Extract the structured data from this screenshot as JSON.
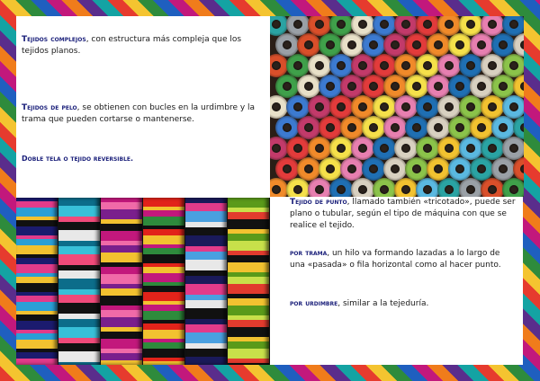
{
  "left_panel": {
    "p1_term": "Tejidos complejos",
    "p1_text": ", con estructura más compleja que los tejidos planos.",
    "p2_term": "Tejidos de pelo",
    "p2_text": ", se obtienen con bucles en la urdimbre y la trama que pueden cortarse o mantenerse.",
    "p3_term": "Doble tela o tejido reversible."
  },
  "right_panel": {
    "p4_term": "Tejido de punto",
    "p4_text": ", llamado también «tricotado», puede ser plano o tubular, según el tipo de máquina con que se realice el tejido.",
    "p5_term": "por trama",
    "p5_text": ", un hilo va formando lazadas a lo largo de una «pasada» o fila horizontal como al hacer punto.",
    "p6_term": "por urdimbre",
    "p6_text": ", similar a la tejeduría."
  },
  "colors": {
    "term_blue": "#1a1f7a",
    "panel_bg": "#ffffff"
  }
}
